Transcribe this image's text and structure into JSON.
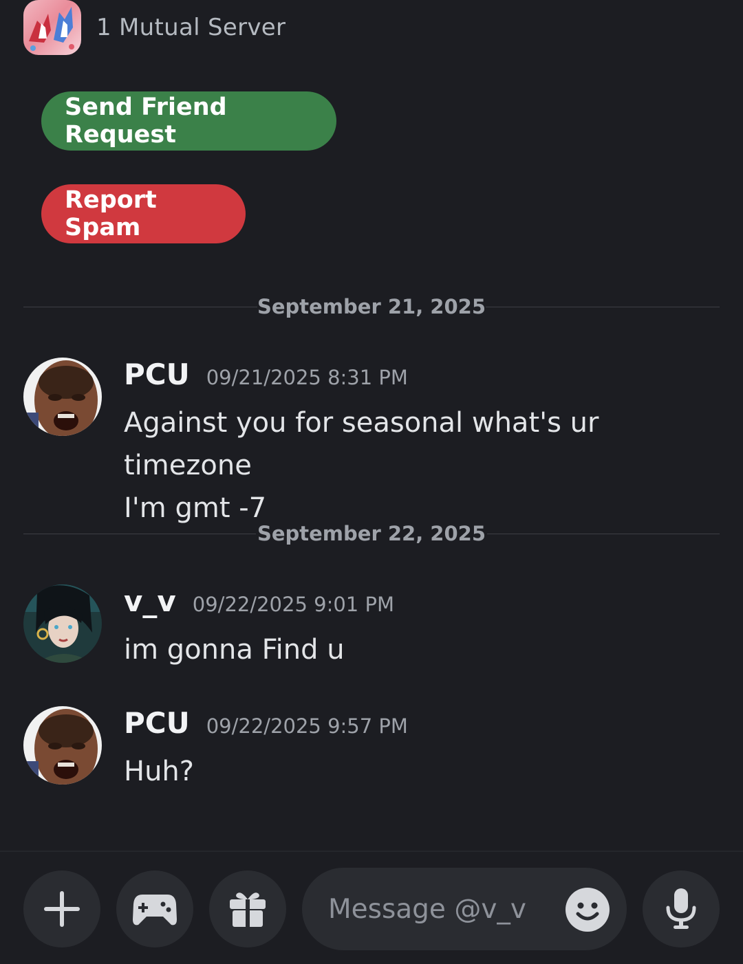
{
  "mutual": {
    "label": "1 Mutual Server",
    "server_icon": "pokemon-latias-latios-server-icon"
  },
  "actions": {
    "friend_request_label": "Send Friend Request",
    "friend_request_color": "#3b8149",
    "report_spam_label": "Report Spam",
    "report_spam_color": "#d0393f"
  },
  "dividers": [
    {
      "date": "September 21, 2025"
    },
    {
      "date": "September 22, 2025"
    }
  ],
  "messages": [
    {
      "author": "PCU",
      "timestamp": "09/21/2025 8:31 PM",
      "lines": [
        "Against you for seasonal what's ur timezone",
        "I'm gmt -7"
      ],
      "avatar": "pcu-avatar"
    },
    {
      "author": "v_v",
      "timestamp": "09/22/2025 9:01 PM",
      "lines": [
        "im gonna Find u"
      ],
      "avatar": "v_v-avatar"
    },
    {
      "author": "PCU",
      "timestamp": "09/22/2025 9:57 PM",
      "lines": [
        "Huh?"
      ],
      "avatar": "pcu-avatar"
    }
  ],
  "composer": {
    "placeholder": "Message @v_v",
    "buttons": [
      "plus-icon",
      "gamepad-icon",
      "gift-icon",
      "emoji-icon",
      "microphone-icon"
    ]
  }
}
